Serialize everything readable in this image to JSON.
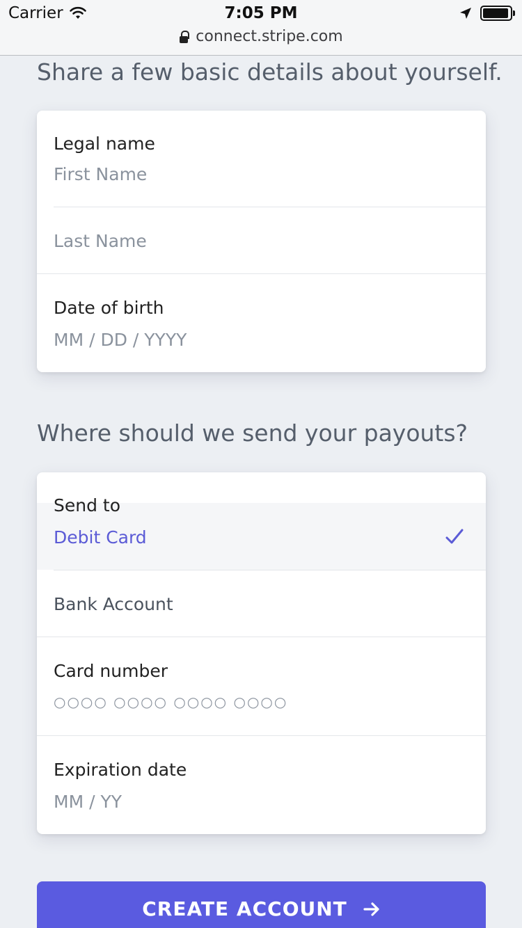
{
  "status_bar": {
    "carrier": "Carrier",
    "time": "7:05 PM"
  },
  "browser": {
    "url": "connect.stripe.com"
  },
  "personal": {
    "heading": "Share a few basic details about yourself.",
    "legal_name_label": "Legal name",
    "first_name_placeholder": "First Name",
    "last_name_placeholder": "Last Name",
    "dob_label": "Date of birth",
    "dob_placeholder": "MM / DD / YYYY"
  },
  "payouts": {
    "heading": "Where should we send your payouts?",
    "send_to_label": "Send to",
    "options": [
      {
        "label": "Debit Card",
        "selected": true
      },
      {
        "label": "Bank Account",
        "selected": false
      }
    ],
    "card_number_label": "Card number",
    "card_number_placeholder": "○○○○ ○○○○ ○○○○ ○○○○",
    "expiration_label": "Expiration date",
    "expiration_placeholder": "MM / YY"
  },
  "submit": {
    "label": "CREATE ACCOUNT"
  },
  "colors": {
    "accent": "#5a5be0",
    "selected_text": "#5b5bd6",
    "background": "#eceff3"
  },
  "icons": {
    "wifi": "wifi-icon",
    "location": "location-arrow-icon",
    "battery": "battery-icon",
    "lock": "lock-icon",
    "check": "checkmark-icon",
    "arrow": "arrow-right-icon"
  }
}
